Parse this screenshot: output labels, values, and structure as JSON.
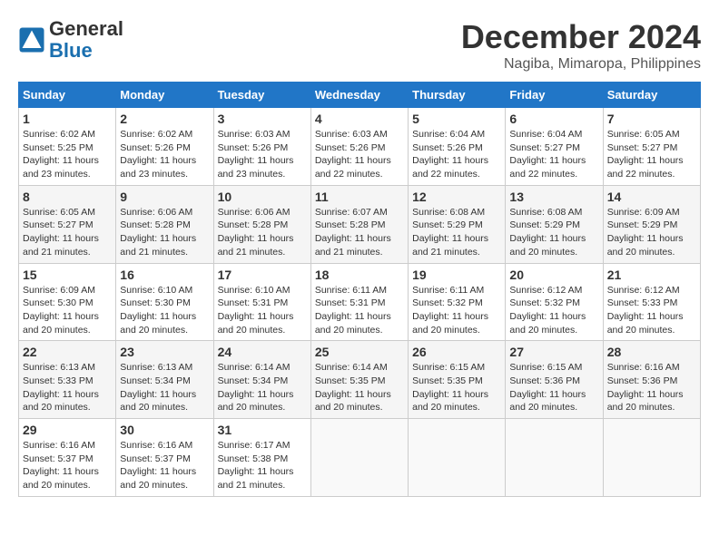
{
  "header": {
    "logo_line1": "General",
    "logo_line2": "Blue",
    "month_title": "December 2024",
    "location": "Nagiba, Mimaropa, Philippines"
  },
  "days_of_week": [
    "Sunday",
    "Monday",
    "Tuesday",
    "Wednesday",
    "Thursday",
    "Friday",
    "Saturday"
  ],
  "weeks": [
    [
      {
        "day": "1",
        "sunrise": "6:02 AM",
        "sunset": "5:25 PM",
        "daylight": "11 hours and 23 minutes."
      },
      {
        "day": "2",
        "sunrise": "6:02 AM",
        "sunset": "5:26 PM",
        "daylight": "11 hours and 23 minutes."
      },
      {
        "day": "3",
        "sunrise": "6:03 AM",
        "sunset": "5:26 PM",
        "daylight": "11 hours and 23 minutes."
      },
      {
        "day": "4",
        "sunrise": "6:03 AM",
        "sunset": "5:26 PM",
        "daylight": "11 hours and 22 minutes."
      },
      {
        "day": "5",
        "sunrise": "6:04 AM",
        "sunset": "5:26 PM",
        "daylight": "11 hours and 22 minutes."
      },
      {
        "day": "6",
        "sunrise": "6:04 AM",
        "sunset": "5:27 PM",
        "daylight": "11 hours and 22 minutes."
      },
      {
        "day": "7",
        "sunrise": "6:05 AM",
        "sunset": "5:27 PM",
        "daylight": "11 hours and 22 minutes."
      }
    ],
    [
      {
        "day": "8",
        "sunrise": "6:05 AM",
        "sunset": "5:27 PM",
        "daylight": "11 hours and 21 minutes."
      },
      {
        "day": "9",
        "sunrise": "6:06 AM",
        "sunset": "5:28 PM",
        "daylight": "11 hours and 21 minutes."
      },
      {
        "day": "10",
        "sunrise": "6:06 AM",
        "sunset": "5:28 PM",
        "daylight": "11 hours and 21 minutes."
      },
      {
        "day": "11",
        "sunrise": "6:07 AM",
        "sunset": "5:28 PM",
        "daylight": "11 hours and 21 minutes."
      },
      {
        "day": "12",
        "sunrise": "6:08 AM",
        "sunset": "5:29 PM",
        "daylight": "11 hours and 21 minutes."
      },
      {
        "day": "13",
        "sunrise": "6:08 AM",
        "sunset": "5:29 PM",
        "daylight": "11 hours and 20 minutes."
      },
      {
        "day": "14",
        "sunrise": "6:09 AM",
        "sunset": "5:29 PM",
        "daylight": "11 hours and 20 minutes."
      }
    ],
    [
      {
        "day": "15",
        "sunrise": "6:09 AM",
        "sunset": "5:30 PM",
        "daylight": "11 hours and 20 minutes."
      },
      {
        "day": "16",
        "sunrise": "6:10 AM",
        "sunset": "5:30 PM",
        "daylight": "11 hours and 20 minutes."
      },
      {
        "day": "17",
        "sunrise": "6:10 AM",
        "sunset": "5:31 PM",
        "daylight": "11 hours and 20 minutes."
      },
      {
        "day": "18",
        "sunrise": "6:11 AM",
        "sunset": "5:31 PM",
        "daylight": "11 hours and 20 minutes."
      },
      {
        "day": "19",
        "sunrise": "6:11 AM",
        "sunset": "5:32 PM",
        "daylight": "11 hours and 20 minutes."
      },
      {
        "day": "20",
        "sunrise": "6:12 AM",
        "sunset": "5:32 PM",
        "daylight": "11 hours and 20 minutes."
      },
      {
        "day": "21",
        "sunrise": "6:12 AM",
        "sunset": "5:33 PM",
        "daylight": "11 hours and 20 minutes."
      }
    ],
    [
      {
        "day": "22",
        "sunrise": "6:13 AM",
        "sunset": "5:33 PM",
        "daylight": "11 hours and 20 minutes."
      },
      {
        "day": "23",
        "sunrise": "6:13 AM",
        "sunset": "5:34 PM",
        "daylight": "11 hours and 20 minutes."
      },
      {
        "day": "24",
        "sunrise": "6:14 AM",
        "sunset": "5:34 PM",
        "daylight": "11 hours and 20 minutes."
      },
      {
        "day": "25",
        "sunrise": "6:14 AM",
        "sunset": "5:35 PM",
        "daylight": "11 hours and 20 minutes."
      },
      {
        "day": "26",
        "sunrise": "6:15 AM",
        "sunset": "5:35 PM",
        "daylight": "11 hours and 20 minutes."
      },
      {
        "day": "27",
        "sunrise": "6:15 AM",
        "sunset": "5:36 PM",
        "daylight": "11 hours and 20 minutes."
      },
      {
        "day": "28",
        "sunrise": "6:16 AM",
        "sunset": "5:36 PM",
        "daylight": "11 hours and 20 minutes."
      }
    ],
    [
      {
        "day": "29",
        "sunrise": "6:16 AM",
        "sunset": "5:37 PM",
        "daylight": "11 hours and 20 minutes."
      },
      {
        "day": "30",
        "sunrise": "6:16 AM",
        "sunset": "5:37 PM",
        "daylight": "11 hours and 20 minutes."
      },
      {
        "day": "31",
        "sunrise": "6:17 AM",
        "sunset": "5:38 PM",
        "daylight": "11 hours and 21 minutes."
      },
      null,
      null,
      null,
      null
    ]
  ],
  "labels": {
    "sunrise": "Sunrise:",
    "sunset": "Sunset:",
    "daylight": "Daylight:"
  }
}
